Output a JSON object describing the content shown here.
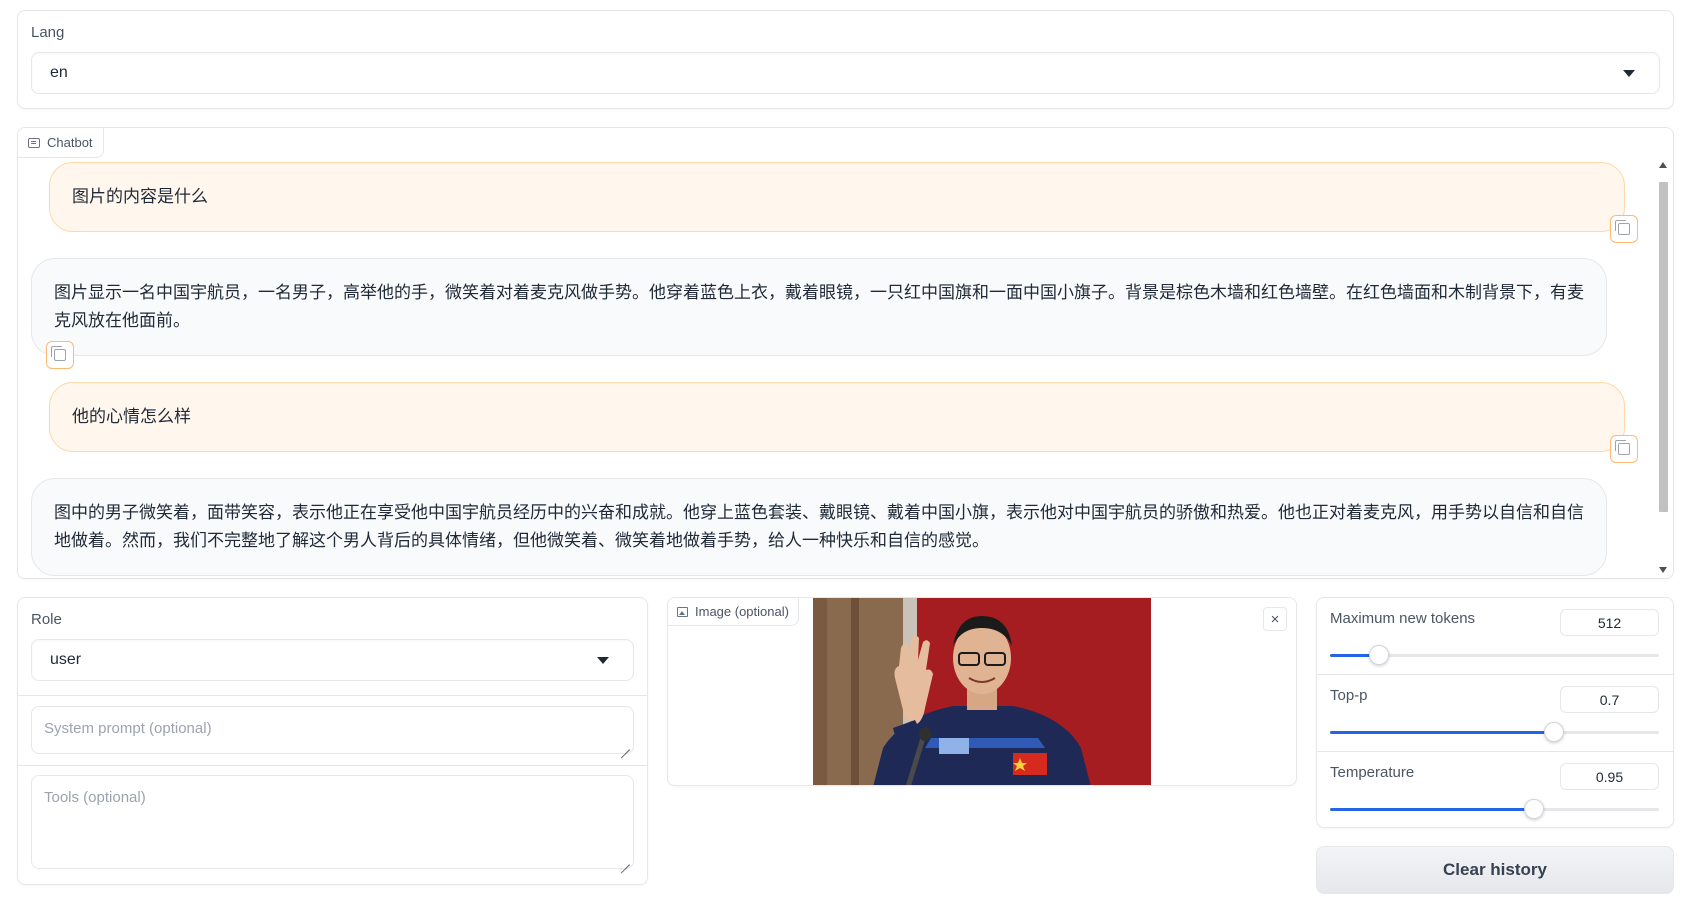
{
  "lang": {
    "label": "Lang",
    "value": "en"
  },
  "chatbot": {
    "label": "Chatbot",
    "messages": [
      {
        "role": "user",
        "text": "图片的内容是什么"
      },
      {
        "role": "assistant",
        "text": "图片显示一名中国宇航员，一名男子，高举他的手，微笑着对着麦克风做手势。他穿着蓝色上衣，戴着眼镜，一只红中国旗和一面中国小旗子。背景是棕色木墙和红色墙壁。在红色墙面和木制背景下，有麦克风放在他面前。"
      },
      {
        "role": "user",
        "text": "他的心情怎么样"
      },
      {
        "role": "assistant",
        "text": "图中的男子微笑着，面带笑容，表示他正在享受他中国宇航员经历中的兴奋和成就。他穿上蓝色套装、戴眼镜、戴着中国小旗，表示他对中国宇航员的骄傲和热爱。他也正对着麦克风，用手势以自信和自信地做着。然而，我们不完整地了解这个男人背后的具体情绪，但他微笑着、微笑着地做着手势，给人一种快乐和自信的感觉。"
      }
    ]
  },
  "role": {
    "label": "Role",
    "value": "user"
  },
  "system_prompt": {
    "placeholder": "System prompt (optional)"
  },
  "tools": {
    "placeholder": "Tools (optional)"
  },
  "image": {
    "label": "Image (optional)",
    "close_glyph": "×"
  },
  "sliders": [
    {
      "label": "Maximum new tokens",
      "value": "512",
      "fraction": 0.15
    },
    {
      "label": "Top-p",
      "value": "0.7",
      "fraction": 0.68
    },
    {
      "label": "Temperature",
      "value": "0.95",
      "fraction": 0.62
    }
  ],
  "clear_button": {
    "label": "Clear history"
  },
  "colors": {
    "accent": "#2563eb",
    "user_bubble": "#fff7ed",
    "user_border": "#fed7aa",
    "bot_bubble": "#f9fafb"
  }
}
